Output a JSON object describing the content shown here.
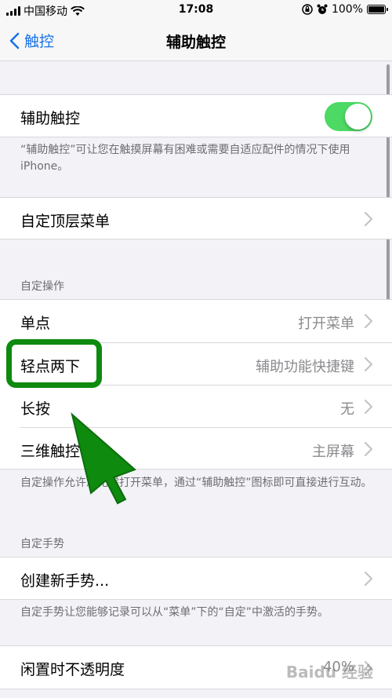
{
  "status_bar": {
    "carrier": "中国移动",
    "time": "17:08",
    "battery": "100%"
  },
  "nav": {
    "back_label": "触控",
    "title": "辅助触控"
  },
  "assistive_touch": {
    "label": "辅助触控",
    "enabled": true,
    "footer": "“辅助触控”可让您在触摸屏幕有困难或需要自适应配件的情况下使用 iPhone。"
  },
  "top_menu": {
    "label": "自定顶层菜单"
  },
  "custom_actions": {
    "header": "自定操作",
    "items": [
      {
        "label": "单点",
        "value": "打开菜单"
      },
      {
        "label": "轻点两下",
        "value": "辅助功能快捷键"
      },
      {
        "label": "长按",
        "value": "无"
      },
      {
        "label": "三维触控",
        "value": "主屏幕"
      }
    ],
    "footer": "自定操作允许您无需打开菜单，通过“辅助触控”图标即可直接进行互动。"
  },
  "custom_gestures": {
    "header": "自定手势",
    "create_label": "创建新手势...",
    "footer": "自定手势让您能够记录可以从“菜单”下的“自定”中激活的手势。"
  },
  "idle_opacity": {
    "label": "闲置时不透明度",
    "value": "40%"
  },
  "watermark": "Baidu 经验",
  "colors": {
    "accent": "#1a73e8",
    "toggle_on": "#4cd964",
    "annotation": "#0e8a0e"
  }
}
